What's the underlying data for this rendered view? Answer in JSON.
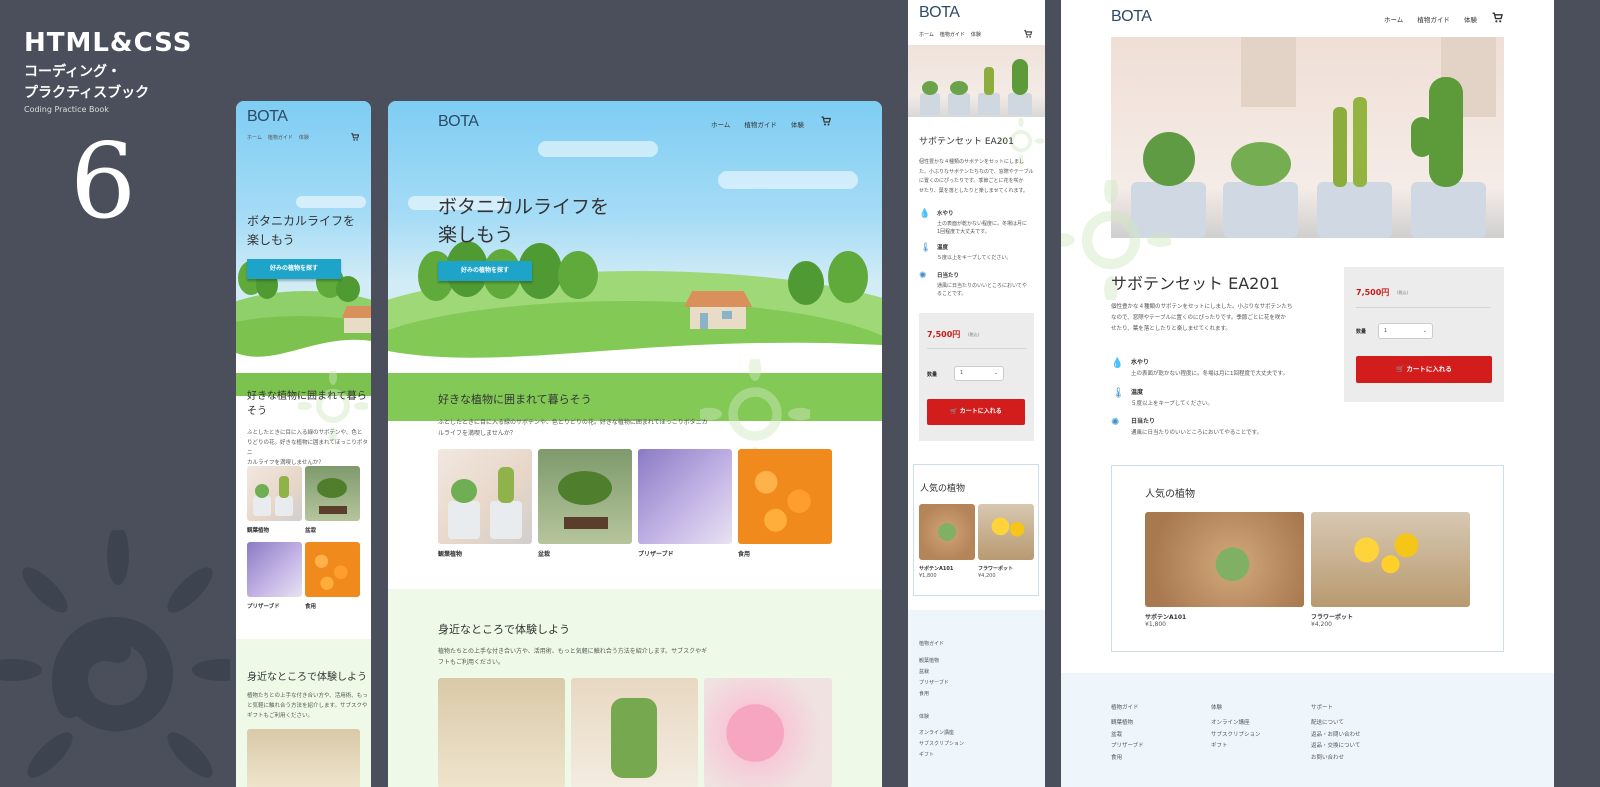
{
  "cover": {
    "title": "HTML&CSS",
    "subtitle_line1": "コーディング・",
    "subtitle_line2": "プラクティスブック",
    "tagline": "Coding Practice Book",
    "number": "6"
  },
  "site": {
    "logo": "BOTA",
    "nav": [
      "ホーム",
      "植物ガイド",
      "体験"
    ],
    "hero_title_line1": "ボタニカルライフを",
    "hero_title_line2": "楽しもう",
    "hero_title_mobile_line1": "ボタニカルライフを",
    "hero_title_mobile_line2": "楽しもう",
    "hero_button": "好みの植物を探す",
    "section1_title": "好きな植物に囲まれて暮らそう",
    "section1_title_m1": "好きな植物に囲まれて暮ら",
    "section1_title_m2": "そう",
    "section1_text_l1": "ふとしたときに目に入る緑のサボテンや、色とりどりの花。好きな植物に囲まれてほっこりボタニカ",
    "section1_text_l2": "ルライフを満喫しませんか？",
    "section1_text_m1": "ふとしたときに目に入る緑のサボテンや、色と",
    "section1_text_m2": "りどりの花。好きな植物に囲まれてほっこりボタニ",
    "section1_text_m3": "カルライフを満喫しませんか？",
    "categories": [
      "観葉植物",
      "盆栽",
      "プリザーブド",
      "食用"
    ],
    "section2_title": "身近なところで体験しよう",
    "section2_text_l1": "植物たちとの上手な付き合い方や、活用術、もっと気軽に触れ合う方法を紹介します。サブスクやギ",
    "section2_text_l2": "フトもご利用ください。",
    "section2_text_m1": "植物たちとの上手な付き合い方や、活用術、もっ",
    "section2_text_m2": "と気軽に触れ合う方法を紹介します。サブスクや",
    "section2_text_m3": "ギフトもご利用ください。"
  },
  "product": {
    "name": "サボテンセット EA201",
    "desc_l1": "個性豊かな４種類のサボテンをセットにしました。小ぶりなサボテンたち",
    "desc_l2": "なので、窓際やテーブルに置くのにぴったりです。季節ごとに花を咲か",
    "desc_l3": "せたり、葉を落としたりと楽しませてくれます。",
    "desc_m1": "個性豊かな４種類のサボテンをセットにしまし",
    "desc_m2": "た。小ぶりなサボテンたちなので、窓際やテーブル",
    "desc_m3": "に置くのにぴったりです。季節ごとに花を咲か",
    "desc_m4": "せたり、葉を落としたりと楽しませてくれます。",
    "care": [
      {
        "icon": "water-drop-icon",
        "title": "水やり",
        "text": "土の表面が乾かない程度に。冬場は月に1回程度で大丈夫です。",
        "text_m1": "土の表面が乾かない程度に。冬場は月に",
        "text_m2": "1回程度で大丈夫です。"
      },
      {
        "icon": "thermometer-icon",
        "title": "温度",
        "text": "５度以上をキープしてください。",
        "text_m1": "５度以上をキープしてください。",
        "text_m2": ""
      },
      {
        "icon": "sun-icon",
        "title": "日当たり",
        "text": "通風に日当たりのいいところにおいてやることです。",
        "text_m1": "通風に日当たりのいいところにおいてや",
        "text_m2": "ることです。"
      }
    ],
    "price": "7,500円",
    "tax": "(税込)",
    "qty_label": "数量",
    "qty_value": "1",
    "cart_button": "カートに入れる",
    "popular_title": "人気の植物",
    "popular": [
      {
        "name": "サボテンA101",
        "price": "¥1,800"
      },
      {
        "name": "フラワーポット",
        "price": "¥4,200"
      }
    ],
    "footer": [
      {
        "title": "植物ガイド",
        "links": [
          "観葉植物",
          "盆栽",
          "プリザーブド",
          "食用"
        ]
      },
      {
        "title": "体験",
        "links": [
          "オンライン講座",
          "サブスクリプション",
          "ギフト"
        ]
      },
      {
        "title": "サポート",
        "links": [
          "配送について",
          "返品・お問い合わせ",
          "返品・交換について",
          "お問い合わせ"
        ]
      }
    ]
  },
  "colors": {
    "background": "#4a4f5b",
    "accent_blue": "#1ea3c9",
    "accent_red": "#d31d1d",
    "price_red": "#c81a1a",
    "logo": "#2e4a66"
  }
}
